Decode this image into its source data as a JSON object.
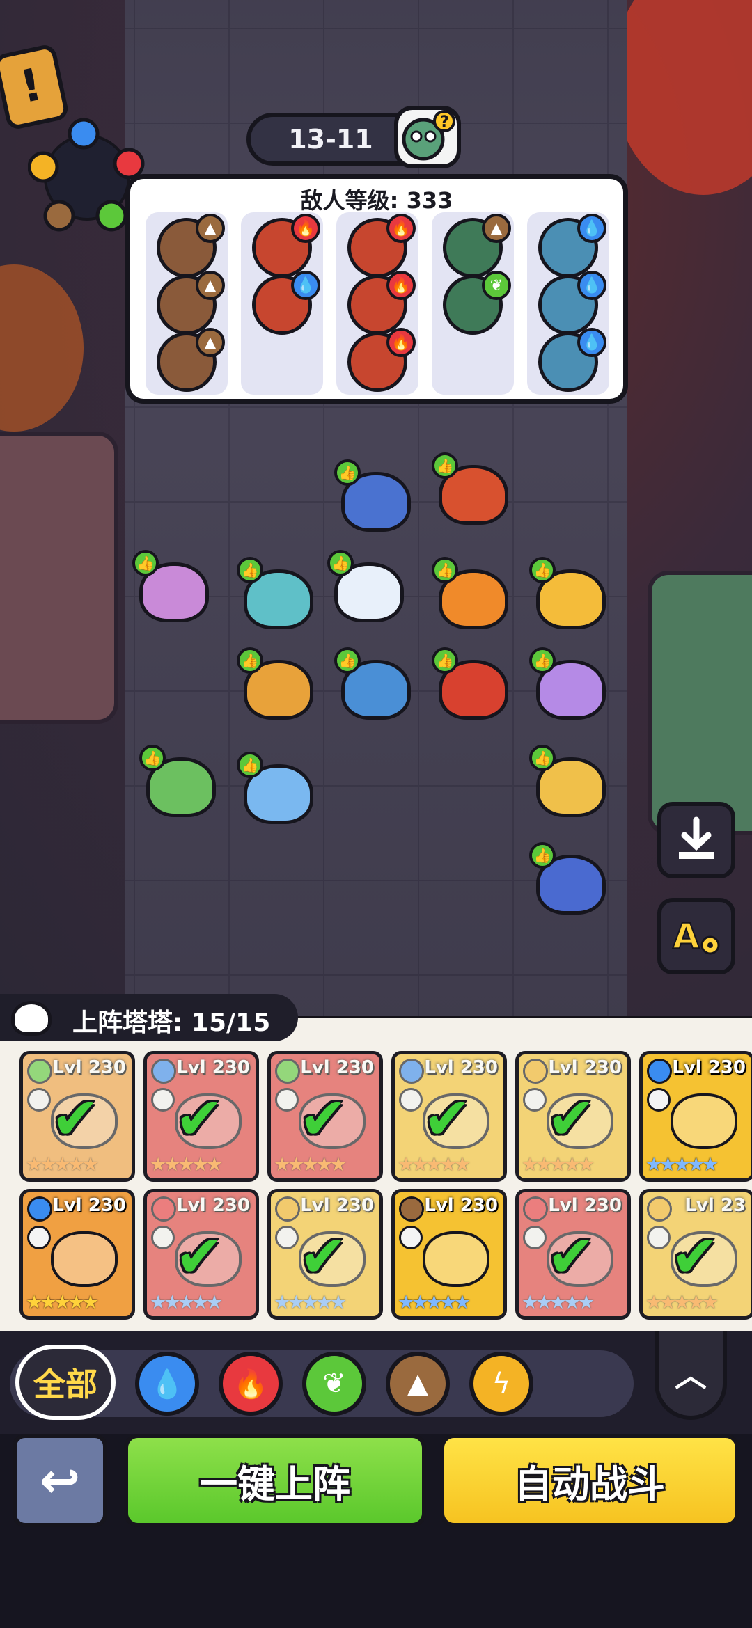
{
  "level": {
    "stage": "13-11"
  },
  "enemy_panel": {
    "title": "敌人等级: 333",
    "columns": [
      {
        "enemies": [
          {
            "element": "earth"
          },
          {
            "element": "earth"
          },
          {
            "element": "earth"
          }
        ]
      },
      {
        "enemies": [
          {
            "element": "fire"
          },
          {
            "element": "water"
          }
        ]
      },
      {
        "enemies": [
          {
            "element": "fire"
          },
          {
            "element": "fire"
          },
          {
            "element": "fire"
          }
        ]
      },
      {
        "enemies": [
          {
            "element": "earth"
          },
          {
            "element": "nature"
          }
        ]
      },
      {
        "enemies": [
          {
            "element": "water"
          },
          {
            "element": "water"
          },
          {
            "element": "water"
          }
        ]
      }
    ]
  },
  "roster": {
    "label": "上阵塔塔: 15/15",
    "cards": [
      {
        "level": "Lvl 230",
        "element": "nature",
        "deployed": true,
        "stars": 5,
        "star_color": "orange",
        "bg": "#f0a042"
      },
      {
        "level": "Lvl 230",
        "element": "water",
        "deployed": true,
        "stars": 5,
        "star_color": "orange",
        "bg": "#e0413f"
      },
      {
        "level": "Lvl 230",
        "element": "nature",
        "deployed": true,
        "stars": 5,
        "star_color": "orange",
        "bg": "#e0413f"
      },
      {
        "level": "Lvl 230",
        "element": "water",
        "deployed": true,
        "stars": 5,
        "star_color": "orange",
        "bg": "#f5c232"
      },
      {
        "level": "Lvl 230",
        "element": "electric",
        "deployed": true,
        "stars": 5,
        "star_color": "orange",
        "bg": "#f5c232"
      },
      {
        "level": "Lvl 230",
        "element": "water",
        "deployed": false,
        "stars": 5,
        "star_color": "blue",
        "bg": "#f5c232"
      },
      {
        "level": "Lvl 230",
        "element": "water",
        "deployed": false,
        "stars": 5,
        "star_color": "gold",
        "bg": "#f0a042"
      },
      {
        "level": "Lvl 230",
        "element": "fire",
        "deployed": true,
        "stars": 5,
        "star_color": "blue",
        "bg": "#e0413f"
      },
      {
        "level": "Lvl 230",
        "element": "electric",
        "deployed": true,
        "stars": 5,
        "star_color": "blue",
        "bg": "#f5c232"
      },
      {
        "level": "Lvl 230",
        "element": "earth",
        "deployed": false,
        "stars": 5,
        "star_color": "blue",
        "bg": "#f5c232"
      },
      {
        "level": "Lvl 230",
        "element": "fire",
        "deployed": true,
        "stars": 5,
        "star_color": "blue",
        "bg": "#e0413f"
      },
      {
        "level": "Lvl 23",
        "element": "electric",
        "deployed": true,
        "stars": 5,
        "star_color": "orange",
        "bg": "#f5c232"
      }
    ]
  },
  "filters": {
    "all_label": "全部",
    "elements": [
      "water",
      "fire",
      "nature",
      "earth",
      "electric"
    ]
  },
  "actions": {
    "deploy_label": "一键上阵",
    "auto_battle_label": "自动战斗"
  },
  "colors": {
    "water": "#3a8cf0",
    "fire": "#e8393f",
    "nature": "#5cc83a",
    "earth": "#9a6a3e",
    "electric": "#f4b325"
  }
}
